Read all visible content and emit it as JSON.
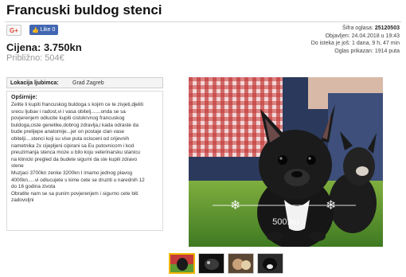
{
  "ad": {
    "title": "Francuski buldog stenci",
    "price_label": "Cijena: 3.750kn",
    "price_approx": "Približno: 504€"
  },
  "social": {
    "gplus_label": "G+",
    "like_label": "Like 0"
  },
  "meta": {
    "id_label": "Šifra oglasa:",
    "id_value": "25120503",
    "published": "Objavljen: 24.04.2018 u 19:43",
    "expires": "Do isteka je još: 1 dana, 9 h, 47 min",
    "views_label": "Oglas prikazan:",
    "views_value": "1914 puta"
  },
  "location": {
    "label": "Lokacija ljubimca:",
    "value": "Grad Zagreb"
  },
  "description": {
    "heading": "Opširnije:",
    "lines": [
      "Zelite li kupiti francuskog buldoga s kojim ce te zivjeti,djeliti",
      "srecu ljubav i radost,vi i vasa obitelj.......onda se sa",
      "povjerenjem odlucite kupiti cistokrvnog francuskog",
      "buldoga,ciste genetike,dobrog zdravlja,i kada odraste da",
      "bude prelijepe anatomije...jer on postaje clan vase",
      "obitelji....stenci koji su vise puta ocisceni od crijevnih",
      "nametnika 2x cijepljeni cipirani sa Eu putovnicom i kod",
      "preuzimanja stenca moze u bilo koju veterinarsku stanicu",
      "na klinicki pregled da budete sigurni da ste kupili zdravo",
      "stene",
      "Muzjaci 3700kn zenke 3200kn I imamo jednog plavog",
      "4000kn.....vi odlucujete s kime cete se druziti u narednih 12",
      "do 16 godina zivota",
      "Obratite nam se sa punim povjerenjem i sigurno cete biti",
      "zadovoljni"
    ]
  },
  "photo": {
    "watermark": "500.eu"
  },
  "colors": {
    "like_blue": "#4267b2",
    "gplus_red": "#dd4b39",
    "thumb_active": "#f0b400"
  }
}
